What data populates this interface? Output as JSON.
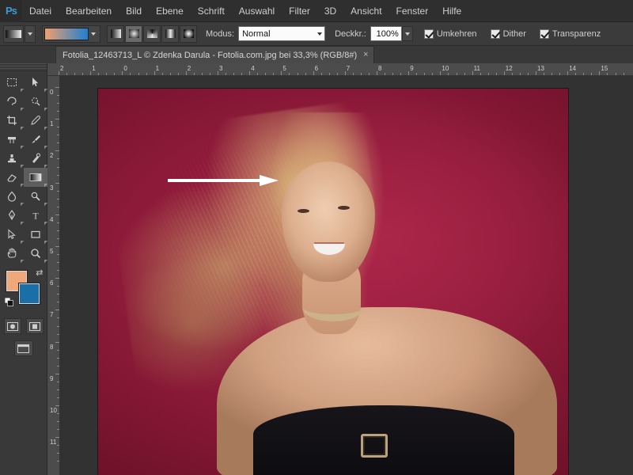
{
  "app": {
    "logo_text": "Ps"
  },
  "menu": {
    "items": [
      {
        "label": "Datei"
      },
      {
        "label": "Bearbeiten"
      },
      {
        "label": "Bild"
      },
      {
        "label": "Ebene"
      },
      {
        "label": "Schrift"
      },
      {
        "label": "Auswahl"
      },
      {
        "label": "Filter"
      },
      {
        "label": "3D"
      },
      {
        "label": "Ansicht"
      },
      {
        "label": "Fenster"
      },
      {
        "label": "Hilfe"
      }
    ]
  },
  "options_bar": {
    "tool_icon_name": "gradient-tool-icon",
    "gradient_preset_colors": [
      "#f0a070",
      "#1f7fd0"
    ],
    "gradient_types": [
      {
        "name": "linear-gradient-button",
        "active": false
      },
      {
        "name": "radial-gradient-button",
        "active": true
      },
      {
        "name": "angle-gradient-button",
        "active": false
      },
      {
        "name": "reflected-gradient-button",
        "active": false
      },
      {
        "name": "diamond-gradient-button",
        "active": false
      }
    ],
    "mode_label": "Modus:",
    "mode_value": "Normal",
    "opacity_label": "Deckkr.:",
    "opacity_value": "100%",
    "checkboxes": [
      {
        "label": "Umkehren",
        "checked": true
      },
      {
        "label": "Dither",
        "checked": true
      },
      {
        "label": "Transparenz",
        "checked": true
      }
    ]
  },
  "document_tab": {
    "title": "Fotolia_12463713_L © Zdenka Darula - Fotolia.com.jpg bei 33,3% (RGB/8#)",
    "close_label": "×"
  },
  "toolbar": {
    "tools": [
      {
        "name": "tool-rectangular-marquee",
        "selected": false
      },
      {
        "name": "tool-move",
        "selected": false
      },
      {
        "name": "tool-lasso",
        "selected": false
      },
      {
        "name": "tool-quick-selection",
        "selected": false
      },
      {
        "name": "tool-crop",
        "selected": false
      },
      {
        "name": "tool-eyedropper",
        "selected": false
      },
      {
        "name": "tool-spot-healing-brush",
        "selected": false
      },
      {
        "name": "tool-brush",
        "selected": false
      },
      {
        "name": "tool-clone-stamp",
        "selected": false
      },
      {
        "name": "tool-history-brush",
        "selected": false
      },
      {
        "name": "tool-eraser",
        "selected": false
      },
      {
        "name": "tool-gradient",
        "selected": true
      },
      {
        "name": "tool-blur",
        "selected": false
      },
      {
        "name": "tool-dodge",
        "selected": false
      },
      {
        "name": "tool-pen",
        "selected": false
      },
      {
        "name": "tool-horizontal-type",
        "selected": false
      },
      {
        "name": "tool-path-selection",
        "selected": false
      },
      {
        "name": "tool-rectangle-shape",
        "selected": false
      },
      {
        "name": "tool-hand",
        "selected": false
      },
      {
        "name": "tool-zoom",
        "selected": false
      }
    ],
    "foreground_color": "#efa879",
    "background_color": "#1a6fa8",
    "quick_mask_name": "quick-mask-button",
    "screen_mode_name": "screen-mode-button"
  },
  "rulers": {
    "unit": "cm",
    "horizontal_ticks": [
      "2",
      "1",
      "0",
      "1",
      "2",
      "3",
      "4",
      "5",
      "6",
      "7",
      "8",
      "9",
      "10",
      "11",
      "12",
      "13",
      "14",
      "15"
    ],
    "vertical_ticks": [
      "0",
      "1",
      "2",
      "3",
      "4",
      "5",
      "6",
      "7",
      "8",
      "9",
      "10",
      "11"
    ]
  },
  "canvas": {
    "zoom": "33,3%",
    "color_mode": "RGB/8#",
    "annotation": {
      "name": "white-arrow-annotation",
      "color": "#ffffff"
    },
    "background_color": "#8d1a39"
  }
}
